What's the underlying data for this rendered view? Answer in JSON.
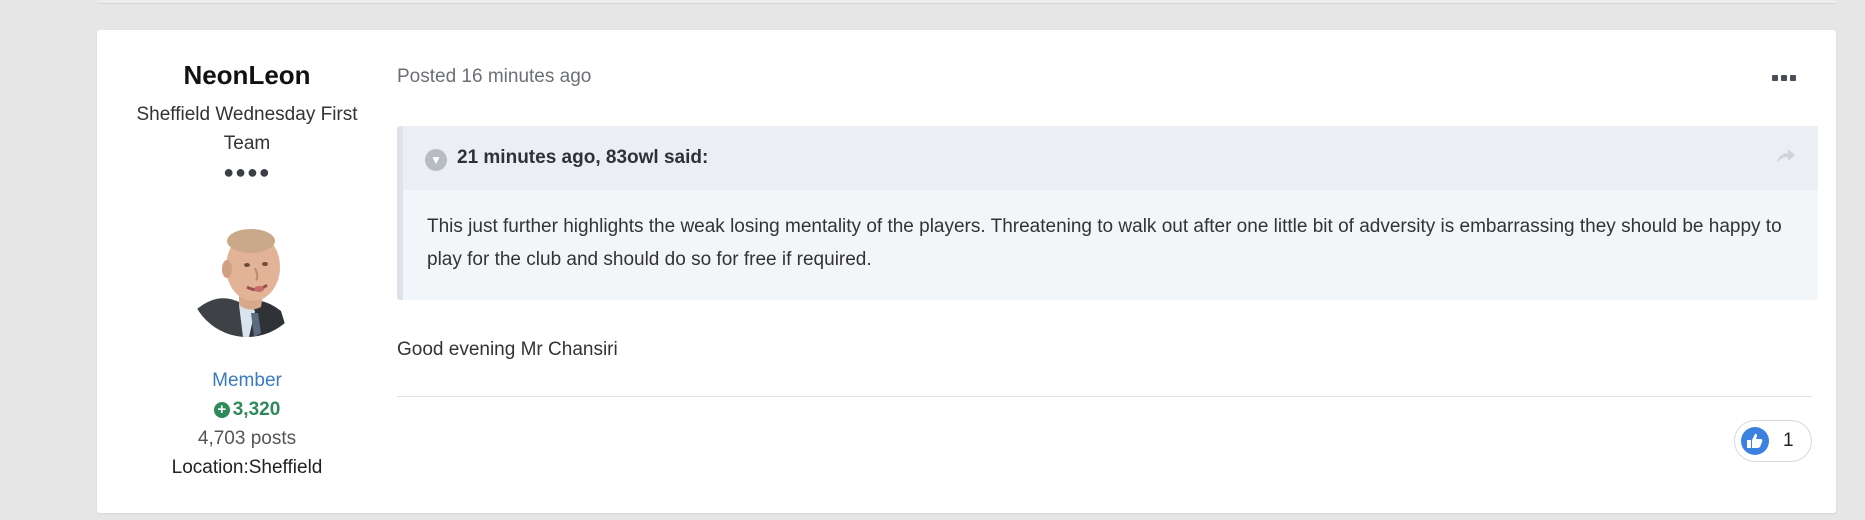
{
  "author": {
    "name": "NeonLeon",
    "rank_title": "Sheffield Wednesday First Team",
    "rank_pips": "●●●●",
    "group": "Member",
    "reputation": "3,320",
    "post_count": "4,703 posts",
    "location": "Location:Sheffield"
  },
  "post": {
    "posted": "Posted 16 minutes ago",
    "quote": {
      "citation": "21 minutes ago, 83owl said:",
      "text": "This just further highlights the weak losing mentality of the players. Threatening to walk out after one little bit of adversity is embarrassing they should be happy to play for the club and should do so for free if required."
    },
    "body": "Good evening Mr Chansiri",
    "reactions": {
      "like_count": "1"
    }
  },
  "colors": {
    "page_bg": "#e6e6e6",
    "group_link": "#3a7abf",
    "reputation": "#2f8a5a",
    "like_blue": "#3b82e0"
  }
}
